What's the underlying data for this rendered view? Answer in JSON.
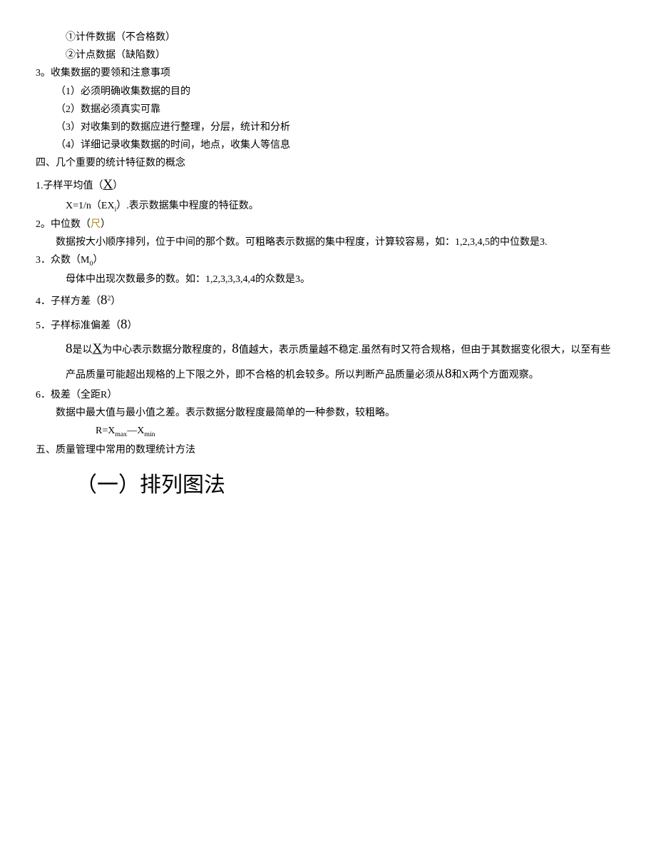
{
  "lines": {
    "l1": "①计件数据（不合格数）",
    "l2": "②计点数据（缺陷数）",
    "l3": "3。收集数据的要领和注意事项",
    "l4": "（1）必须明确收集数据的目的",
    "l5": "（2）数据必须真实可靠",
    "l6": "（3）对收集到的数据应进行整理，分层，统计和分析",
    "l7": "（4）详细记录收集数据的时间，地点，收集人等信息",
    "l8": "四、几个重要的统计特征数的概念",
    "l9a": "1.子样平均值（",
    "l9b": "X",
    "l9c": "）",
    "l10a": "X=1/n（EX",
    "l10b": "i",
    "l10c": "）.表示数据集中程度的特征数。",
    "l11a": "2。中位数（",
    "l11b": "尺",
    "l11c": "）",
    "l12": "数据按大小顺序排列，位于中间的那个数。可粗略表示数据的集中程度，计算较容易，如：1,2,3,4,5的中位数是3.",
    "l13a": "3．众数（M",
    "l13b": "0",
    "l13c": "）",
    "l14": "母体中出现次数最多的数。如：1,2,3,3,3,4,4的众数是3。",
    "l15a": "4．子样方差（",
    "l15b": "8",
    "l15c": "2",
    "l15d": "）",
    "l16a": "5．子样标准偏差（",
    "l16b": "8",
    "l16c": "）",
    "l17a": "8",
    "l17b": "是以",
    "l17c": "X",
    "l17d": "为中心表示数据分散程度的，",
    "l17e": "8",
    "l17f": "值越大，表示质量越不稳定.虽然有时又符合规格，但由于其数据变化很大，以至有些产品质量可能超出规格的上下限之外，即不合格的机会较多。所以判断产品质量必须从",
    "l17g": "8",
    "l17h": "和X两个方面观察。",
    "l18": "6．极差（全距R）",
    "l19": "数据中最大值与最小值之差。表示数据分散程度最简单的一种参数，较粗略。",
    "l20a": "R=X",
    "l20b": "max",
    "l20c": "—X",
    "l20d": "min",
    "l21": "五、质量管理中常用的数理统计方法",
    "l22": "（一）排列图法"
  }
}
